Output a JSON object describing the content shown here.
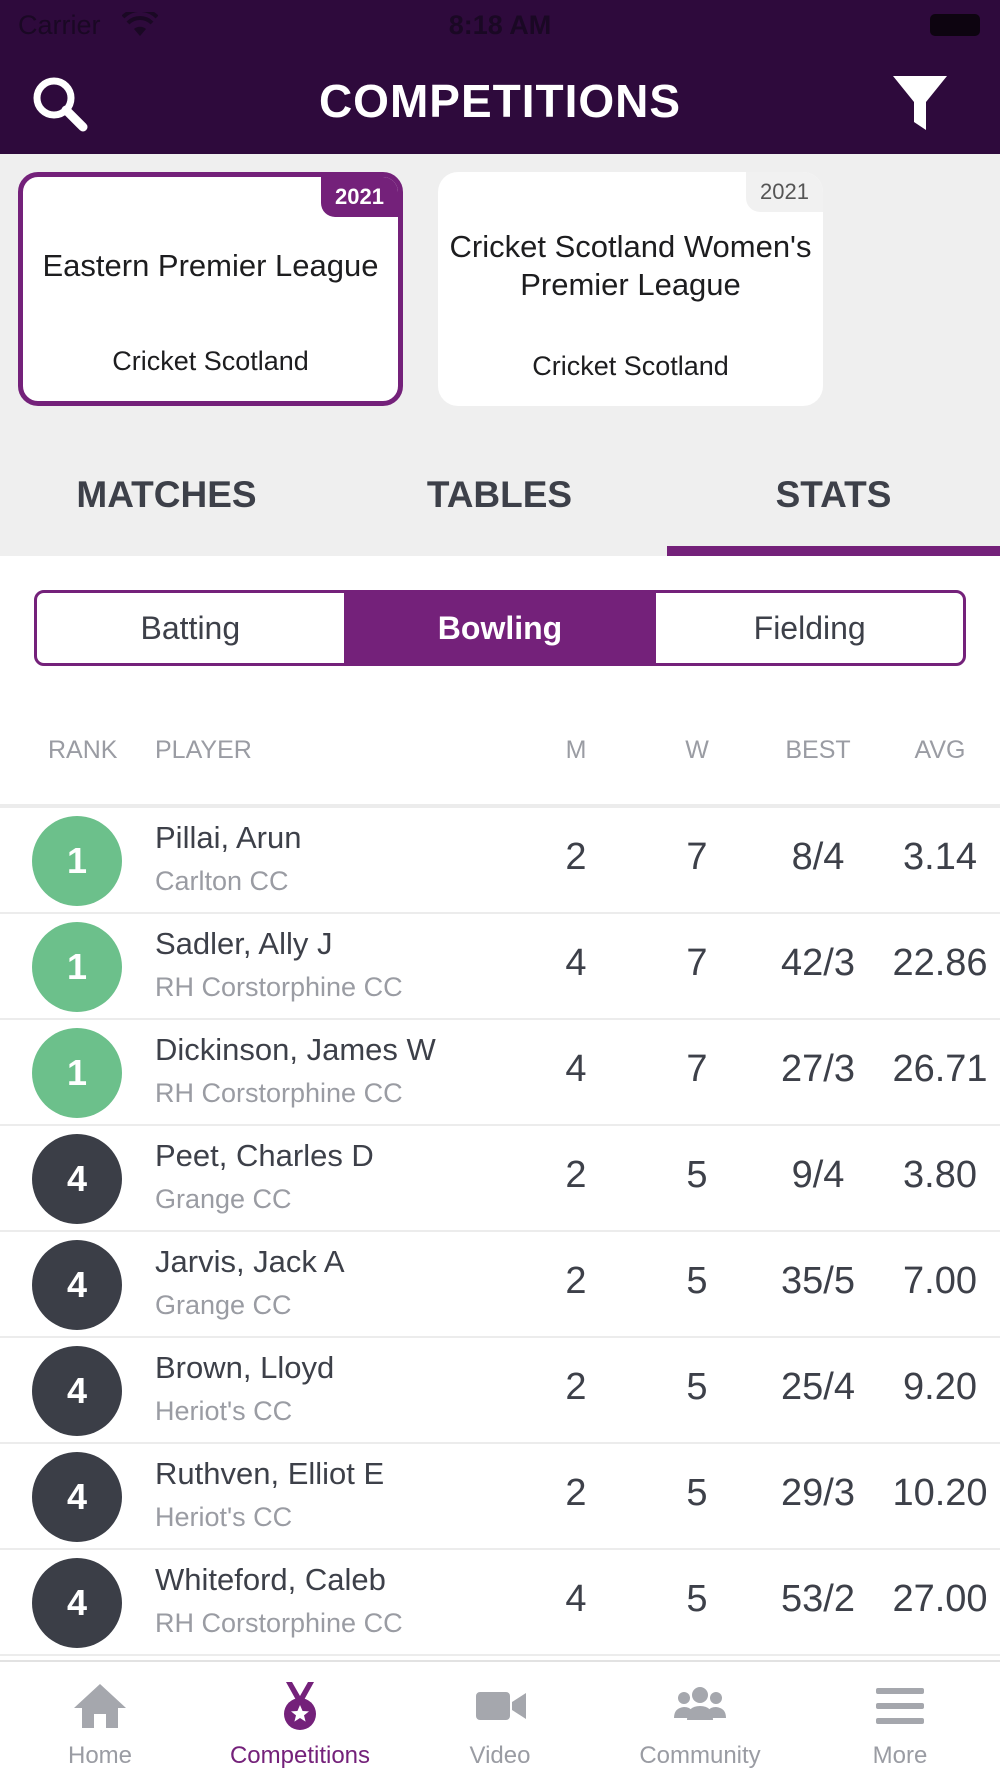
{
  "status": {
    "carrier": "Carrier",
    "time": "8:18 AM"
  },
  "header": {
    "title": "COMPETITIONS"
  },
  "cards": [
    {
      "year": "2021",
      "name": "Eastern Premier League",
      "org": "Cricket Scotland"
    },
    {
      "year": "2021",
      "name": "Cricket Scotland Women's Premier League",
      "org": "Cricket Scotland"
    }
  ],
  "tabs": [
    "MATCHES",
    "TABLES",
    "STATS"
  ],
  "segments": [
    "Batting",
    "Bowling",
    "Fielding"
  ],
  "columns": {
    "rank": "RANK",
    "player": "PLAYER",
    "m": "M",
    "w": "W",
    "best": "BEST",
    "avg": "AVG"
  },
  "rows": [
    {
      "rank": "1",
      "name": "Pillai, Arun",
      "club": "Carlton CC",
      "m": "2",
      "w": "7",
      "best": "8/4",
      "avg": "3.14"
    },
    {
      "rank": "1",
      "name": "Sadler, Ally J",
      "club": "RH Corstorphine CC",
      "m": "4",
      "w": "7",
      "best": "42/3",
      "avg": "22.86"
    },
    {
      "rank": "1",
      "name": "Dickinson, James W",
      "club": "RH Corstorphine CC",
      "m": "4",
      "w": "7",
      "best": "27/3",
      "avg": "26.71"
    },
    {
      "rank": "4",
      "name": "Peet, Charles D",
      "club": "Grange CC",
      "m": "2",
      "w": "5",
      "best": "9/4",
      "avg": "3.80"
    },
    {
      "rank": "4",
      "name": "Jarvis, Jack A",
      "club": "Grange CC",
      "m": "2",
      "w": "5",
      "best": "35/5",
      "avg": "7.00"
    },
    {
      "rank": "4",
      "name": "Brown, Lloyd",
      "club": "Heriot's CC",
      "m": "2",
      "w": "5",
      "best": "25/4",
      "avg": "9.20"
    },
    {
      "rank": "4",
      "name": "Ruthven, Elliot E",
      "club": "Heriot's CC",
      "m": "2",
      "w": "5",
      "best": "29/3",
      "avg": "10.20"
    },
    {
      "rank": "4",
      "name": "Whiteford, Caleb",
      "club": "RH Corstorphine CC",
      "m": "4",
      "w": "5",
      "best": "53/2",
      "avg": "27.00"
    }
  ],
  "nav": [
    {
      "label": "Home",
      "icon": "home-icon"
    },
    {
      "label": "Competitions",
      "icon": "medal-icon"
    },
    {
      "label": "Video",
      "icon": "video-camera-icon"
    },
    {
      "label": "Community",
      "icon": "people-icon"
    },
    {
      "label": "More",
      "icon": "menu-icon"
    }
  ],
  "colors": {
    "header_bg": "#2e0a3c",
    "accent": "#74217a",
    "rank_top": "#6cc08b",
    "rank_other": "#3b3e47"
  }
}
